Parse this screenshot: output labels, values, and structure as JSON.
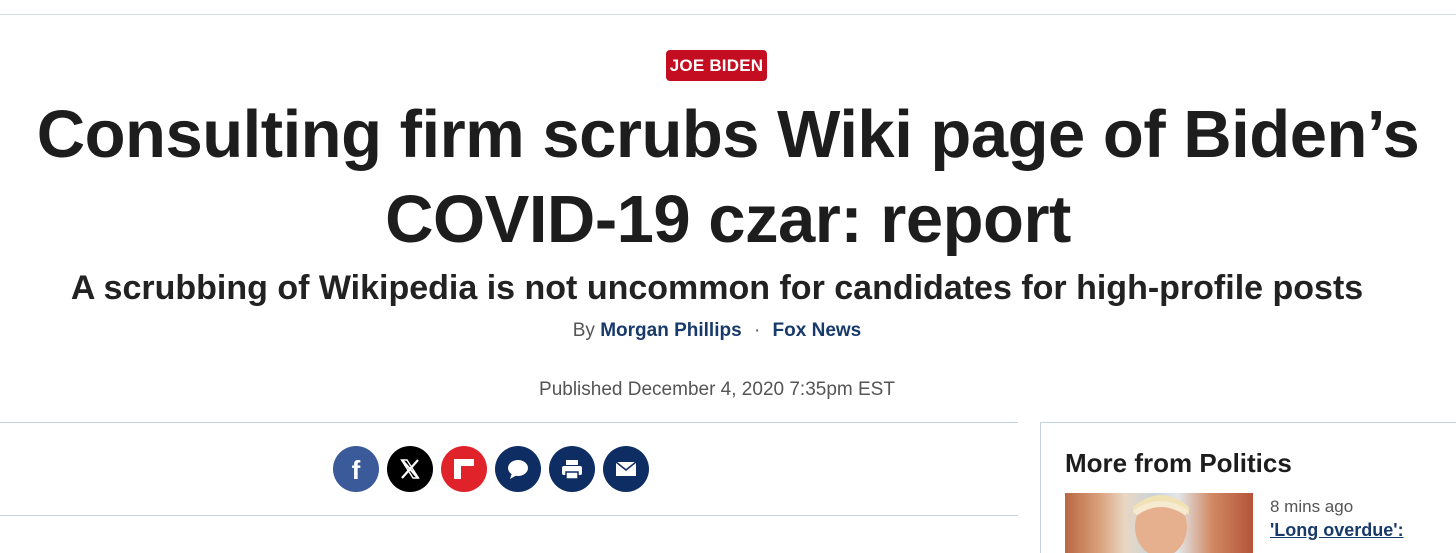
{
  "article": {
    "category": "JOE BIDEN",
    "headline_line1": "Consulting firm scrubs Wiki page of Biden’s",
    "headline_line2": "COVID-19 czar: report",
    "subheadline": "A scrubbing of Wikipedia is not uncommon for candidates for high-profile posts",
    "byline": {
      "prefix": "By",
      "author": "Morgan Phillips",
      "separator": "·",
      "source": "Fox News"
    },
    "published": "Published December 4, 2020 7:35pm EST"
  },
  "share": {
    "buttons": [
      {
        "name": "facebook",
        "icon": "facebook-icon",
        "color": "#3b5a9a"
      },
      {
        "name": "x",
        "icon": "x-icon",
        "color": "#000000"
      },
      {
        "name": "flipboard",
        "icon": "flipboard-icon",
        "color": "#e0222a"
      },
      {
        "name": "comments",
        "icon": "comment-icon",
        "color": "#0e2e63"
      },
      {
        "name": "print",
        "icon": "printer-icon",
        "color": "#0e2e63"
      },
      {
        "name": "email",
        "icon": "envelope-icon",
        "color": "#0e2e63"
      }
    ]
  },
  "sidebar": {
    "title": "More from Politics",
    "story": {
      "time": "8 mins ago",
      "title_partial": "'Long overdue':"
    }
  },
  "colors": {
    "category_badge": "#c40d20",
    "link": "#183a6b",
    "headline": "#1d1d1d",
    "rule": "#c6d3e2"
  }
}
